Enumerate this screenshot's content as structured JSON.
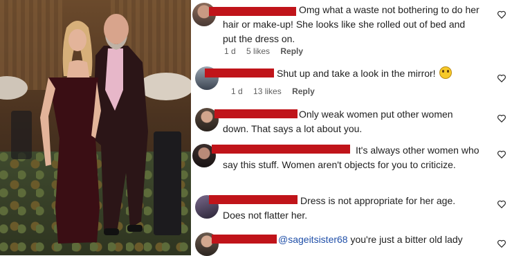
{
  "comments": [
    {
      "id": "c1",
      "text": "Omg what a waste not bothering to do her hair or make-up! She looks like she rolled out of bed and put the dress on.",
      "time": "1 d",
      "likes": "5 likes",
      "reply": "Reply"
    },
    {
      "id": "c2",
      "text": "Shut up and take a look in the mirror!",
      "emoji": "smiling-face-emoji",
      "time": "1 d",
      "likes": "13 likes",
      "reply": "Reply"
    },
    {
      "id": "c3",
      "text": "Only weak women put other women down. That says a lot about you."
    },
    {
      "id": "c4",
      "text": "It's always other women who say this stuff. Women aren't objects for you to criticize."
    },
    {
      "id": "c5",
      "text": "Dress is not appropriate for her age. Does not flatter her."
    },
    {
      "id": "c6",
      "mention": "@sageitsister68",
      "text": " you're just a bitter old lady"
    }
  ],
  "icons": {
    "like": "heart-outline-icon"
  },
  "colors": {
    "redaction": "#c0141a",
    "mention": "#1f4fa8",
    "text": "#1e1e1e",
    "meta": "#5e5e5e"
  }
}
